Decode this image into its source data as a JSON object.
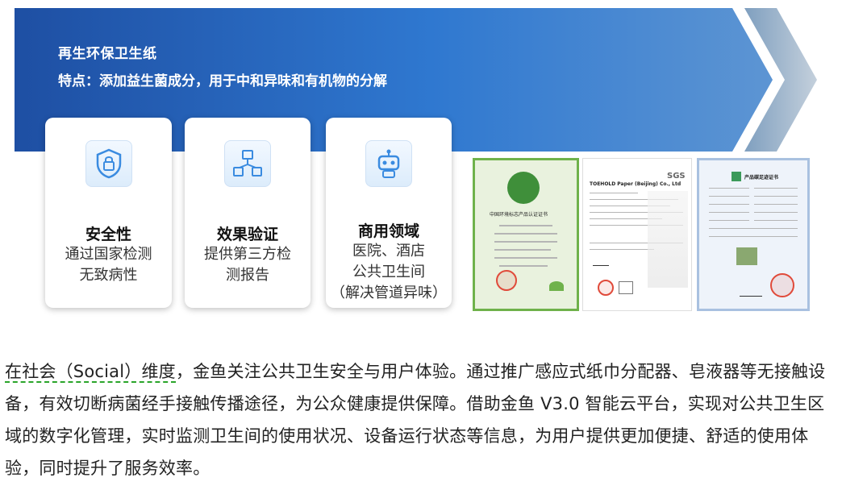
{
  "banner": {
    "title": "再生环保卫生纸",
    "subtitle": "特点：添加益生菌成分，用于中和异味和有机物的分解",
    "gradient": [
      "#1e4fa3",
      "#2f78d0",
      "#8fb4d9"
    ],
    "icon": "chevron-arrow-icon"
  },
  "cards": [
    {
      "icon": "shield-lock-icon",
      "title": "安全性",
      "lines": [
        "通过国家检测",
        "无致病性"
      ]
    },
    {
      "icon": "molecule-cubes-icon",
      "title": "效果验证",
      "lines": [
        "提供第三方检",
        "测报告"
      ]
    },
    {
      "icon": "robot-icon",
      "title": "商用领域",
      "lines": [
        "医院、酒店",
        "公共卫生间",
        "（解决管道异味）"
      ]
    }
  ],
  "certificates": [
    {
      "name": "green-certificate",
      "heading": "中国环境标志产品认证证书"
    },
    {
      "name": "sgs-report",
      "heading": "TOEHOLD Paper (Beijing) Co., Ltd",
      "brand": "SGS"
    },
    {
      "name": "blue-certificate",
      "heading": "产品碳足迹证书"
    }
  ],
  "paragraph": {
    "marked": "在社会（Social）维度",
    "text": "，金鱼关注公共卫生安全与用户体验。通过推广感应式纸巾分配器、皂液器等无接触设备，有效切断病菌经手接触传播途径，为公众健康提供保障。借助金鱼 V3.0 智能云平台，实现对公共卫生区域的数字化管理，实时监测卫生间的使用状况、设备运行状态等信息，为用户提供更加便捷、舒适的使用体验，同时提升了服务效率。"
  }
}
